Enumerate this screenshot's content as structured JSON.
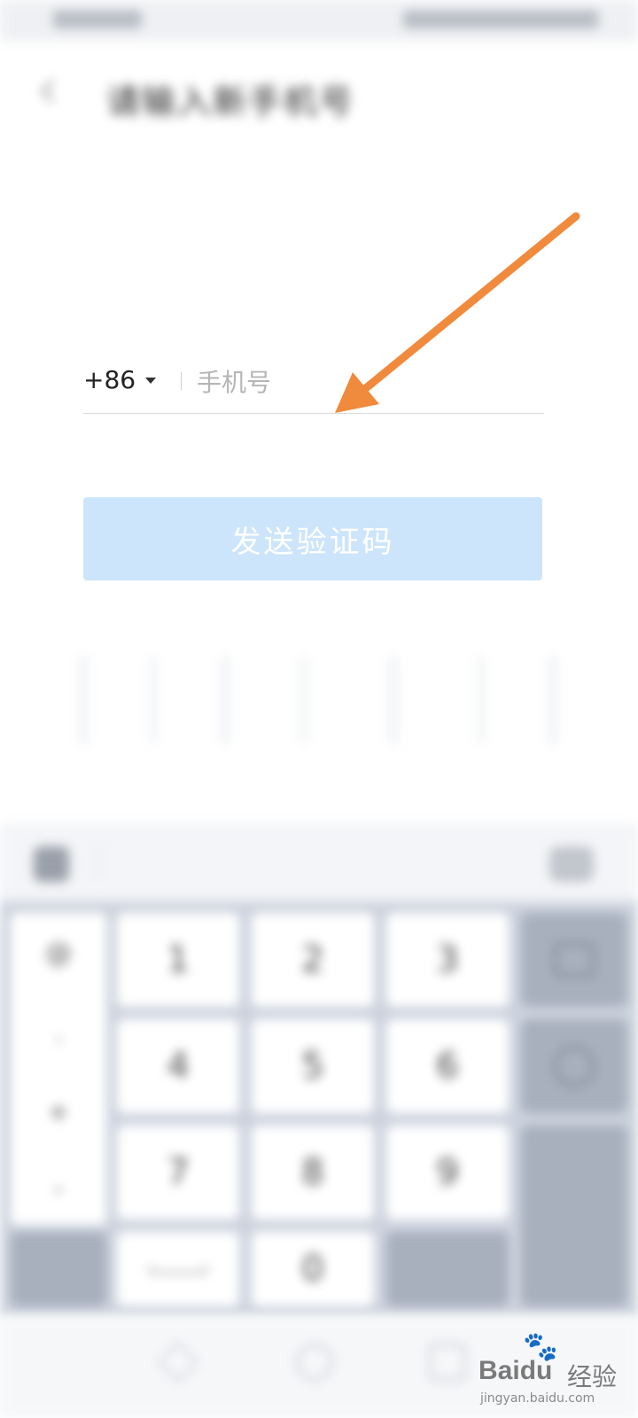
{
  "statusbar": {
    "left_icons": "signal-icons",
    "right_icons": "battery-icons"
  },
  "header": {
    "title": "请输入新手机号",
    "back_icon": "chevron-left-icon"
  },
  "hint": {
    "line1_pre": "",
    "line1_highlight": "",
    "line1_post": "",
    "line2": ""
  },
  "phone": {
    "country_code": "+86",
    "placeholder": "手机号",
    "value": ""
  },
  "send_button": {
    "label": "发送验证码",
    "color": "#cde5fa"
  },
  "annotation": {
    "arrow_color": "#f08a3c"
  },
  "keyboard": {
    "digits": [
      "1",
      "2",
      "3",
      "4",
      "5",
      "6",
      "7",
      "8",
      "9",
      "0"
    ],
    "symbols": [
      "@",
      ".",
      "+",
      "-"
    ],
    "enter_label": "",
    "left_bottom_label": "",
    "right_bottom_label": ""
  },
  "watermark": {
    "brand": "Bai",
    "brand2": "du",
    "cn": "经验",
    "url": "jingyan.baidu.com"
  }
}
